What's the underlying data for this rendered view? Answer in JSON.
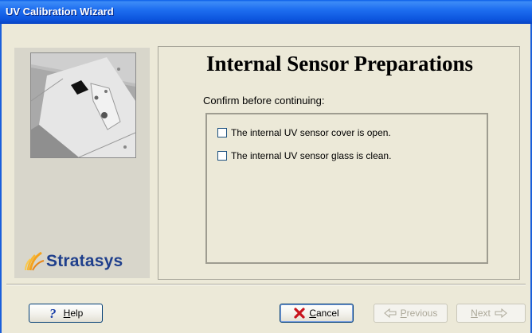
{
  "window": {
    "title": "UV Calibration Wizard"
  },
  "sidebar": {
    "logo_text": "Stratasys"
  },
  "page": {
    "heading": "Internal Sensor Preparations",
    "confirm_label": "Confirm before continuing:"
  },
  "checklist": [
    {
      "label": "The internal UV sensor cover is open.",
      "checked": false
    },
    {
      "label": "The internal UV sensor glass is clean.",
      "checked": false
    }
  ],
  "buttons": {
    "help": {
      "mnemonic": "H",
      "rest": "elp",
      "icon": "question-icon",
      "color": "#1a3fa8"
    },
    "cancel": {
      "mnemonic": "C",
      "rest": "ancel",
      "icon": "x-icon",
      "color": "#c8141e"
    },
    "previous": {
      "mnemonic": "P",
      "rest": "revious",
      "icon": "arrow-left-icon",
      "enabled": false
    },
    "next": {
      "mnemonic": "N",
      "rest": "ext",
      "icon": "arrow-right-icon",
      "enabled": false
    }
  }
}
